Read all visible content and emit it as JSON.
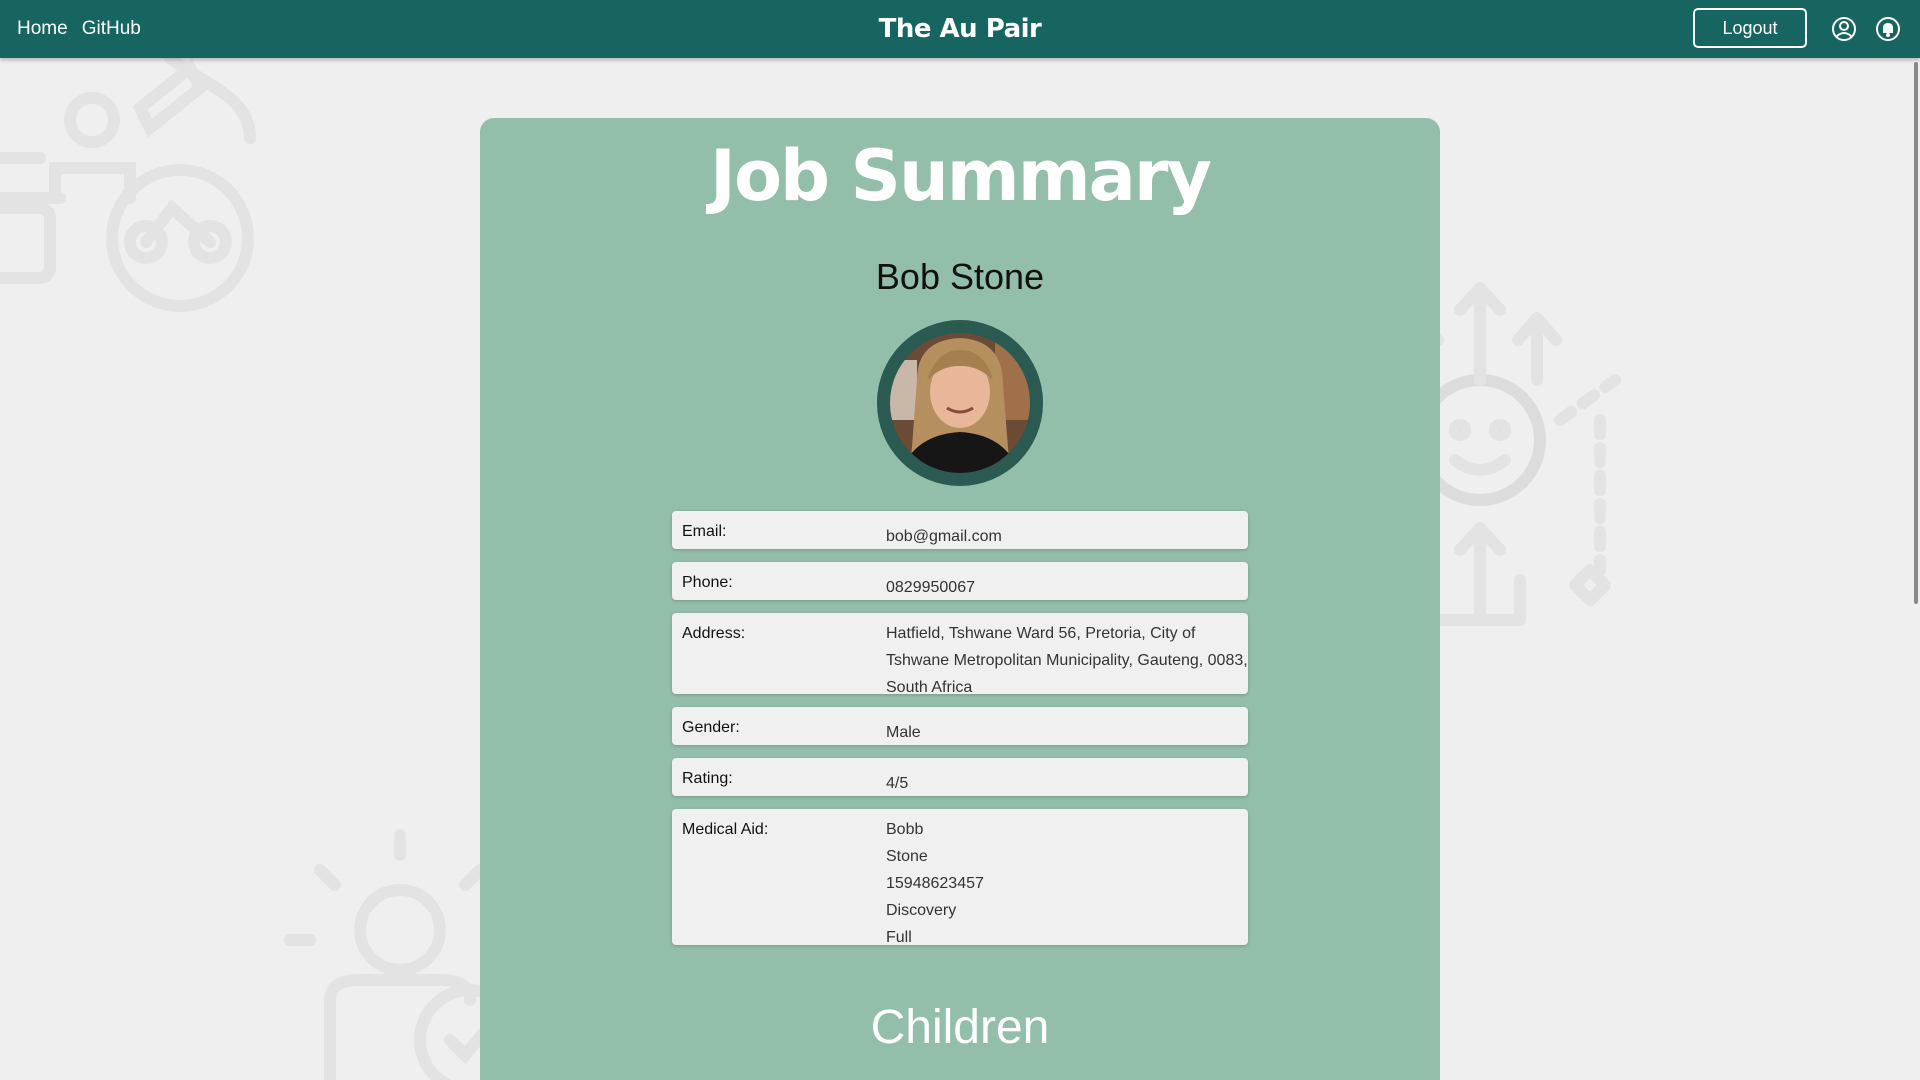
{
  "nav": {
    "home_label": "Home",
    "github_label": "GitHub",
    "brand": "The Au Pair",
    "logout_label": "Logout"
  },
  "page": {
    "title": "Job Summary",
    "name": "Bob Stone",
    "children_heading": "Children"
  },
  "details": {
    "email_label": "Email:",
    "email_value": "bob@gmail.com",
    "phone_label": "Phone:",
    "phone_value": "0829950067",
    "address_label": "Address:",
    "address_lines": [
      "Hatfield, Tshwane Ward 56, Pretoria, City of",
      "Tshwane Metropolitan Municipality, Gauteng, 0083,",
      "South Africa"
    ],
    "gender_label": "Gender:",
    "gender_value": "Male",
    "rating_label": "Rating:",
    "rating_value": "4/5",
    "medical_label": "Medical Aid:",
    "medical_lines": [
      "Bobb",
      "Stone",
      "15948623457",
      "Discovery",
      "Full"
    ]
  },
  "colors": {
    "navbar": "#166561",
    "card": "#93bea9",
    "page_bg": "#efefef",
    "row_bg": "#f0f0f0"
  },
  "icons": [
    "profile-icon",
    "notification-bell-icon"
  ]
}
